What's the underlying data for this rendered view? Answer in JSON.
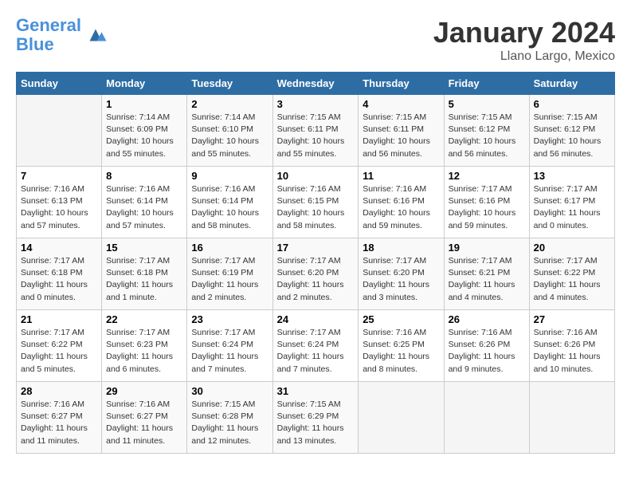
{
  "header": {
    "logo_line1": "General",
    "logo_line2": "Blue",
    "month_year": "January 2024",
    "location": "Llano Largo, Mexico"
  },
  "days_of_week": [
    "Sunday",
    "Monday",
    "Tuesday",
    "Wednesday",
    "Thursday",
    "Friday",
    "Saturday"
  ],
  "weeks": [
    [
      {
        "day": "",
        "info": ""
      },
      {
        "day": "1",
        "info": "Sunrise: 7:14 AM\nSunset: 6:09 PM\nDaylight: 10 hours\nand 55 minutes."
      },
      {
        "day": "2",
        "info": "Sunrise: 7:14 AM\nSunset: 6:10 PM\nDaylight: 10 hours\nand 55 minutes."
      },
      {
        "day": "3",
        "info": "Sunrise: 7:15 AM\nSunset: 6:11 PM\nDaylight: 10 hours\nand 55 minutes."
      },
      {
        "day": "4",
        "info": "Sunrise: 7:15 AM\nSunset: 6:11 PM\nDaylight: 10 hours\nand 56 minutes."
      },
      {
        "day": "5",
        "info": "Sunrise: 7:15 AM\nSunset: 6:12 PM\nDaylight: 10 hours\nand 56 minutes."
      },
      {
        "day": "6",
        "info": "Sunrise: 7:15 AM\nSunset: 6:12 PM\nDaylight: 10 hours\nand 56 minutes."
      }
    ],
    [
      {
        "day": "7",
        "info": "Sunrise: 7:16 AM\nSunset: 6:13 PM\nDaylight: 10 hours\nand 57 minutes."
      },
      {
        "day": "8",
        "info": "Sunrise: 7:16 AM\nSunset: 6:14 PM\nDaylight: 10 hours\nand 57 minutes."
      },
      {
        "day": "9",
        "info": "Sunrise: 7:16 AM\nSunset: 6:14 PM\nDaylight: 10 hours\nand 58 minutes."
      },
      {
        "day": "10",
        "info": "Sunrise: 7:16 AM\nSunset: 6:15 PM\nDaylight: 10 hours\nand 58 minutes."
      },
      {
        "day": "11",
        "info": "Sunrise: 7:16 AM\nSunset: 6:16 PM\nDaylight: 10 hours\nand 59 minutes."
      },
      {
        "day": "12",
        "info": "Sunrise: 7:17 AM\nSunset: 6:16 PM\nDaylight: 10 hours\nand 59 minutes."
      },
      {
        "day": "13",
        "info": "Sunrise: 7:17 AM\nSunset: 6:17 PM\nDaylight: 11 hours\nand 0 minutes."
      }
    ],
    [
      {
        "day": "14",
        "info": "Sunrise: 7:17 AM\nSunset: 6:18 PM\nDaylight: 11 hours\nand 0 minutes."
      },
      {
        "day": "15",
        "info": "Sunrise: 7:17 AM\nSunset: 6:18 PM\nDaylight: 11 hours\nand 1 minute."
      },
      {
        "day": "16",
        "info": "Sunrise: 7:17 AM\nSunset: 6:19 PM\nDaylight: 11 hours\nand 2 minutes."
      },
      {
        "day": "17",
        "info": "Sunrise: 7:17 AM\nSunset: 6:20 PM\nDaylight: 11 hours\nand 2 minutes."
      },
      {
        "day": "18",
        "info": "Sunrise: 7:17 AM\nSunset: 6:20 PM\nDaylight: 11 hours\nand 3 minutes."
      },
      {
        "day": "19",
        "info": "Sunrise: 7:17 AM\nSunset: 6:21 PM\nDaylight: 11 hours\nand 4 minutes."
      },
      {
        "day": "20",
        "info": "Sunrise: 7:17 AM\nSunset: 6:22 PM\nDaylight: 11 hours\nand 4 minutes."
      }
    ],
    [
      {
        "day": "21",
        "info": "Sunrise: 7:17 AM\nSunset: 6:22 PM\nDaylight: 11 hours\nand 5 minutes."
      },
      {
        "day": "22",
        "info": "Sunrise: 7:17 AM\nSunset: 6:23 PM\nDaylight: 11 hours\nand 6 minutes."
      },
      {
        "day": "23",
        "info": "Sunrise: 7:17 AM\nSunset: 6:24 PM\nDaylight: 11 hours\nand 7 minutes."
      },
      {
        "day": "24",
        "info": "Sunrise: 7:17 AM\nSunset: 6:24 PM\nDaylight: 11 hours\nand 7 minutes."
      },
      {
        "day": "25",
        "info": "Sunrise: 7:16 AM\nSunset: 6:25 PM\nDaylight: 11 hours\nand 8 minutes."
      },
      {
        "day": "26",
        "info": "Sunrise: 7:16 AM\nSunset: 6:26 PM\nDaylight: 11 hours\nand 9 minutes."
      },
      {
        "day": "27",
        "info": "Sunrise: 7:16 AM\nSunset: 6:26 PM\nDaylight: 11 hours\nand 10 minutes."
      }
    ],
    [
      {
        "day": "28",
        "info": "Sunrise: 7:16 AM\nSunset: 6:27 PM\nDaylight: 11 hours\nand 11 minutes."
      },
      {
        "day": "29",
        "info": "Sunrise: 7:16 AM\nSunset: 6:27 PM\nDaylight: 11 hours\nand 11 minutes."
      },
      {
        "day": "30",
        "info": "Sunrise: 7:15 AM\nSunset: 6:28 PM\nDaylight: 11 hours\nand 12 minutes."
      },
      {
        "day": "31",
        "info": "Sunrise: 7:15 AM\nSunset: 6:29 PM\nDaylight: 11 hours\nand 13 minutes."
      },
      {
        "day": "",
        "info": ""
      },
      {
        "day": "",
        "info": ""
      },
      {
        "day": "",
        "info": ""
      }
    ]
  ]
}
